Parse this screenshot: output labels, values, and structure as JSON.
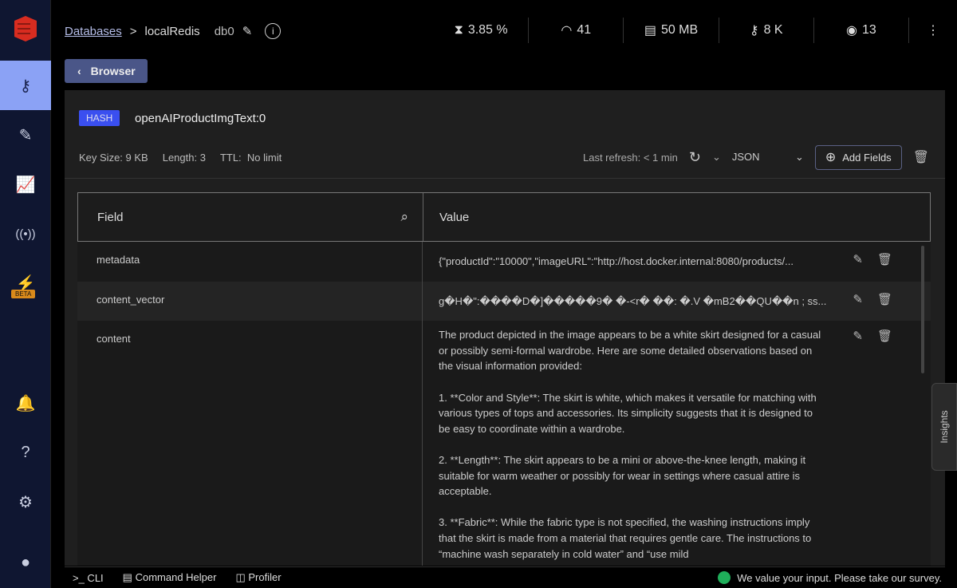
{
  "breadcrumb": {
    "databases": "Databases",
    "separator": ">",
    "db_name": "localRedis",
    "db_index": "db0"
  },
  "stats": {
    "cpu": "3.85 %",
    "ops": "41",
    "memory": "50 MB",
    "keys": "8 K",
    "clients": "13"
  },
  "sidebar": {
    "beta": "BETA"
  },
  "browser_button": "Browser",
  "key": {
    "type": "HASH",
    "name": "openAIProductImgText:0",
    "size": "Key Size: 9 KB",
    "length": "Length: 3",
    "ttl_label": "TTL:",
    "ttl": "No limit"
  },
  "toolbar": {
    "last_refresh": "Last refresh: < 1 min",
    "format": "JSON",
    "add_fields": "Add Fields"
  },
  "table": {
    "headers": {
      "field": "Field",
      "value": "Value"
    },
    "rows": [
      {
        "field": "metadata",
        "value": "{\"productId\":\"10000\",\"imageURL\":\"http://host.docker.internal:8080/products/..."
      },
      {
        "field": "content_vector",
        "value": "g�H�\":����D�]�����9� �-<r� ��: �.V �mB2��QU��n ; ss..."
      },
      {
        "field": "content",
        "value": "The product depicted in the image appears to be a white skirt designed for a casual or possibly semi-formal wardrobe. Here are some detailed observations based on the visual information provided:\n\n1. **Color and Style**: The skirt is white, which makes it versatile for matching with various types of tops and accessories. Its simplicity suggests that it is designed to be easy to coordinate within a wardrobe.\n\n2. **Length**: The skirt appears to be a mini or above-the-knee length, making it suitable for warm weather or possibly for wear in settings where casual attire is acceptable.\n\n3. **Fabric**: While the fabric type is not specified, the washing instructions imply that the skirt is made from a material that requires gentle care. The instructions to “machine wash separately in cold water” and “use mild"
      }
    ]
  },
  "insights": "Insights",
  "bottom": {
    "cli": ">_ CLI",
    "command_helper": "Command Helper",
    "profiler": "Profiler",
    "survey": "We value your input. Please take our survey."
  }
}
